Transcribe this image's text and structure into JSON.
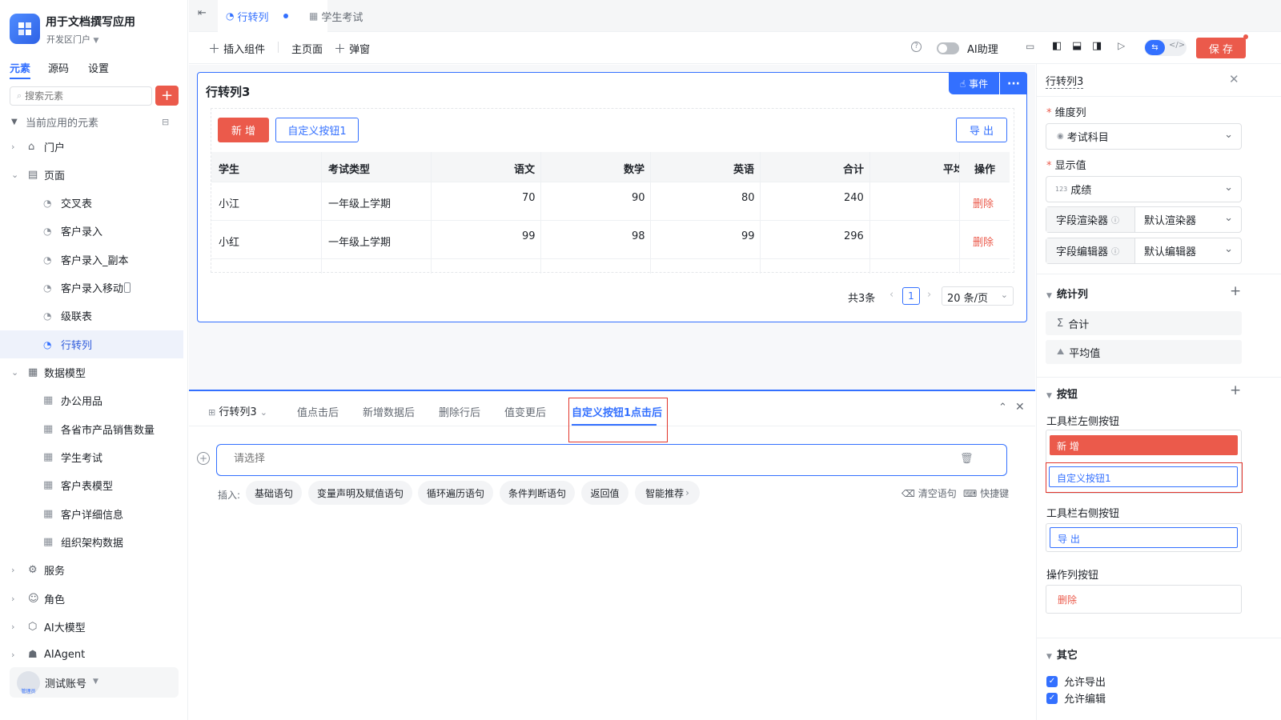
{
  "app": {
    "title": "用于文档撰写应用",
    "portal": "开发区门户"
  },
  "left_tabs": [
    "元素",
    "源码",
    "设置"
  ],
  "search": {
    "placeholder": "搜索元素"
  },
  "tree": {
    "section": "当前应用的元素",
    "portal": "门户",
    "pages": "页面",
    "page_items": [
      "交叉表",
      "客户录入",
      "客户录入_副本",
      "客户录入移动",
      "级联表",
      "行转列"
    ],
    "data_model": "数据模型",
    "model_items": [
      "办公用品",
      "各省市产品销售数量",
      "学生考试",
      "客户表模型",
      "客户详细信息",
      "组织架构数据"
    ],
    "services": "服务",
    "roles": "角色",
    "ai_model": "AI大模型",
    "ai_agent": "AIAgent"
  },
  "account": {
    "name": "测试账号",
    "badge": "管理员"
  },
  "tabs": [
    {
      "label": "行转列"
    },
    {
      "label": "学生考试"
    }
  ],
  "toolbar": {
    "insert": "插入组件",
    "home": "主页面",
    "popup": "弹窗",
    "ai": "AI助理",
    "save": "保 存"
  },
  "widget": {
    "title": "行转列3",
    "event_btn": "事件",
    "more": "···",
    "add_btn": "新 增",
    "custom_btn": "自定义按钮1",
    "export_btn": "导 出",
    "columns": [
      "学生",
      "考试类型",
      "语文",
      "数学",
      "英语",
      "合计",
      "平均",
      "操作"
    ],
    "rows": [
      {
        "student": "小江",
        "type": "一年级上学期",
        "chinese": "70",
        "math": "90",
        "english": "80",
        "total": "240",
        "op": "删除"
      },
      {
        "student": "小红",
        "type": "一年级上学期",
        "chinese": "99",
        "math": "98",
        "english": "99",
        "total": "296",
        "op": "删除"
      }
    ],
    "pager": {
      "total": "共3条",
      "page": "1",
      "size": "20 条/页"
    }
  },
  "events": {
    "selector": "行转列3",
    "tabs": [
      "值点击后",
      "新增数据后",
      "删除行后",
      "值变更后",
      "自定义按钮1点击后"
    ],
    "placeholder": "请选择",
    "insert_label": "插入:",
    "pills": [
      "基础语句",
      "变量声明及赋值语句",
      "循环遍历语句",
      "条件判断语句",
      "返回值",
      "智能推荐"
    ],
    "clear": "清空语句",
    "shortcut": "快捷键"
  },
  "right": {
    "title": "行转列3",
    "dim_label": "维度列",
    "dim_value": "考试科目",
    "val_label": "显示值",
    "val_value": "成绩",
    "renderer_label": "字段渲染器",
    "renderer_value": "默认渲染器",
    "editor_label": "字段编辑器",
    "editor_value": "默认编辑器",
    "stat_section": "统计列",
    "stat_items": [
      "合计",
      "平均值"
    ],
    "btn_section": "按钮",
    "left_btns_label": "工具栏左侧按钮",
    "left_btns": [
      "新 增",
      "自定义按钮1"
    ],
    "right_btns_label": "工具栏右侧按钮",
    "right_btns": [
      "导 出"
    ],
    "op_btns_label": "操作列按钮",
    "op_btns": [
      "删除"
    ],
    "other_section": "其它",
    "checks": [
      "允许导出",
      "允许编辑"
    ]
  },
  "colors": {
    "primary": "#3370ff",
    "danger": "#eb5a4b",
    "highlight": "#e2352b"
  }
}
